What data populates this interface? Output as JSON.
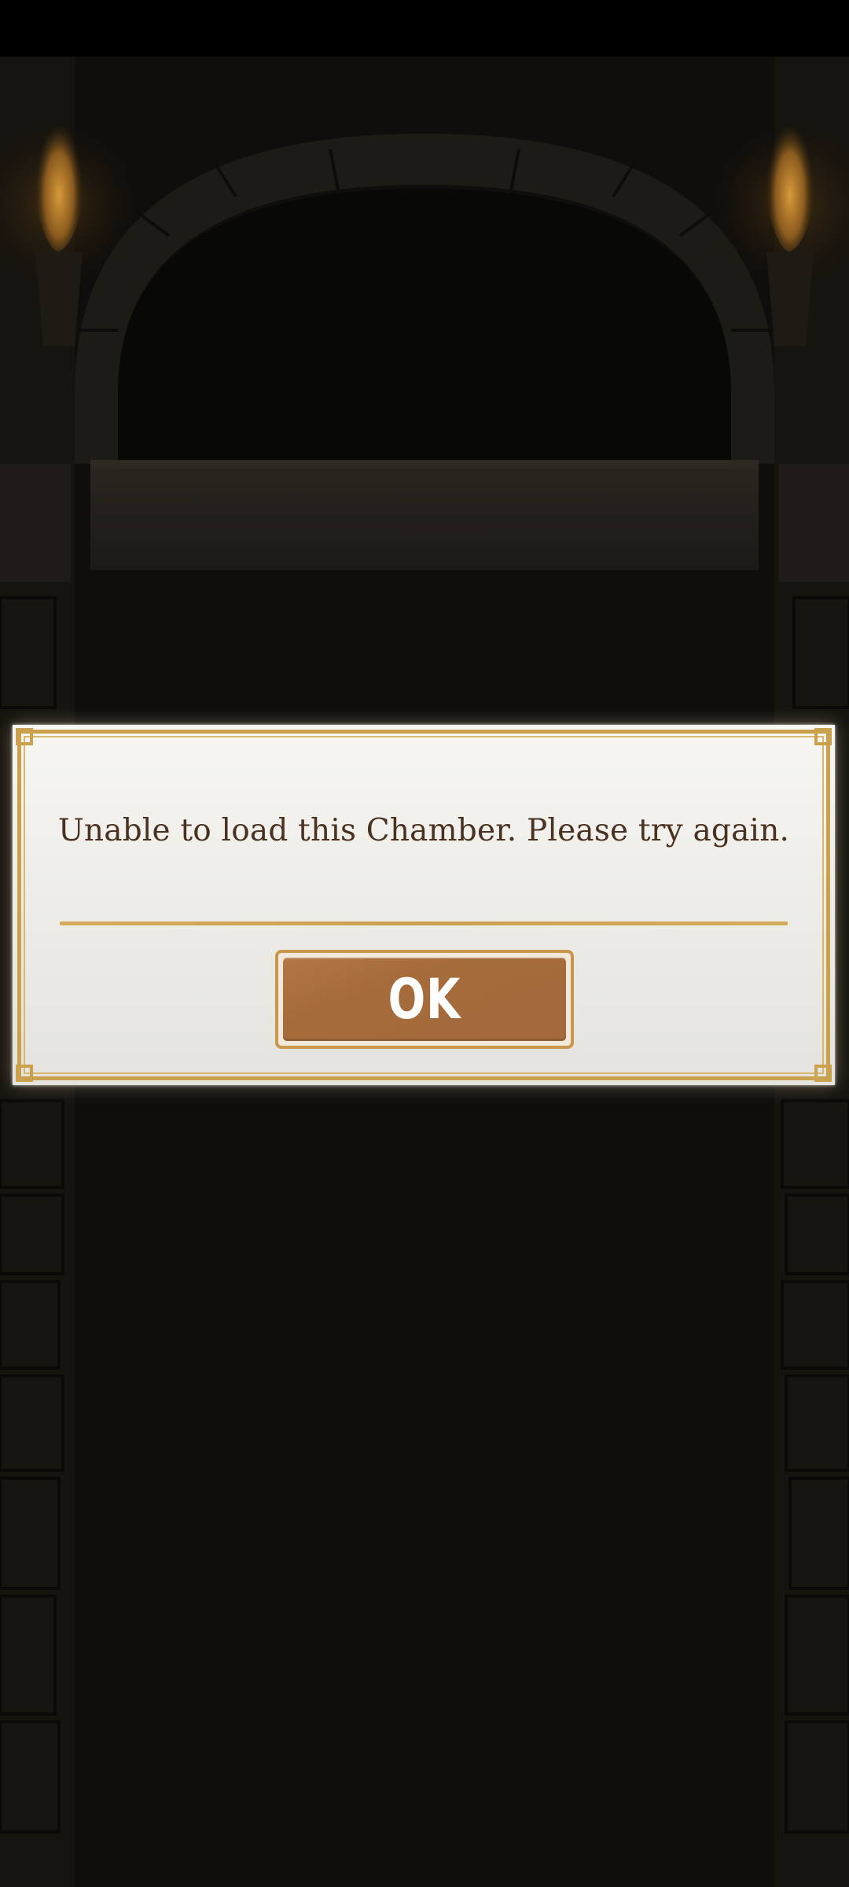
{
  "dialog": {
    "message": "Unable to load this Chamber. Please try again.",
    "ok_label": "OK"
  },
  "colors": {
    "background": "#000000",
    "dialog_bg": "#f0efeb",
    "gold_frame": "#caa24e",
    "message_text": "#4a3222",
    "button_face": "#a66b3b",
    "button_text": "#ffffff"
  },
  "icons": [
    "torch-left-icon",
    "torch-right-icon"
  ]
}
